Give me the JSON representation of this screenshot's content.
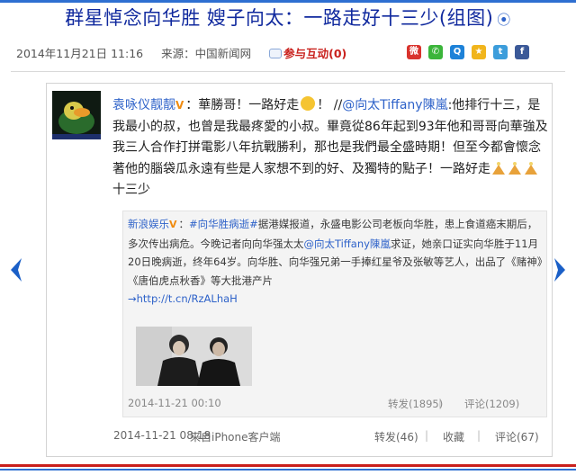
{
  "article": {
    "title": "群星悼念向华胜 嫂子向太：一路走好十三少(组图)",
    "more_icon": "double-chevron-right-icon",
    "date": "2014年11月21日 11:16",
    "source": "来源：中国新闻网",
    "comment_label": "参与互动(0)"
  },
  "share_icons": [
    {
      "name": "weibo",
      "color": "#d9332d",
      "glyph": "微"
    },
    {
      "name": "wechat",
      "color": "#3bb53a",
      "glyph": "微"
    },
    {
      "name": "qq",
      "color": "#1d82d8",
      "glyph": "Q"
    },
    {
      "name": "qzone",
      "color": "#f1b51c",
      "glyph": "★"
    },
    {
      "name": "tencent-weibo",
      "color": "#3c9ddb",
      "glyph": "t"
    },
    {
      "name": "facebook",
      "color": "#3b5998",
      "glyph": "f"
    }
  ],
  "post": {
    "user": "袁咏仪靓靓",
    "text_part1": "：華勝哥！一路好走",
    "text_part2": "！ //",
    "mention": "@向太Tiffany陳嵐",
    "text_part3": ":他排行十三，是我最小的叔，也曾是我最疼愛的小叔。畢竟從86年起到93年他和哥哥向華強及我三人合作打拼電影八年抗戰勝利，那也是我們最全盛時期！但至今都會懷念著他的腦袋瓜永遠有些是人家想不到的好、及獨特的點子！一路好走",
    "text_part4": "十三少",
    "time": "2014-11-21 08:18",
    "via": "来自iPhone客户端",
    "repost_label": "转发(46)",
    "fav_label": "收藏",
    "comment_label": "评论(67)"
  },
  "repost": {
    "user": "新浪娱乐",
    "tag": "#向华胜病逝#",
    "text_part1": "据港媒报道，永盛电影公司老板向华胜，患上食道癌末期后，多次传出病危。今晚记者向向华强太太",
    "mention": "@向太Tiffany陳嵐",
    "text_part2": "求证，她亲口证实向华胜于11月20日晚病逝，终年64岁。向华胜、向华强兄弟一手捧红星爷及张敏等艺人，出品了《赌神》《唐伯虎点秋香》等大批港产片",
    "link": "→http://t.cn/RzALhaH",
    "time": "2014-11-21 00:10",
    "repost_label": "转发(1895)",
    "comment_label": "评论(1209)"
  }
}
